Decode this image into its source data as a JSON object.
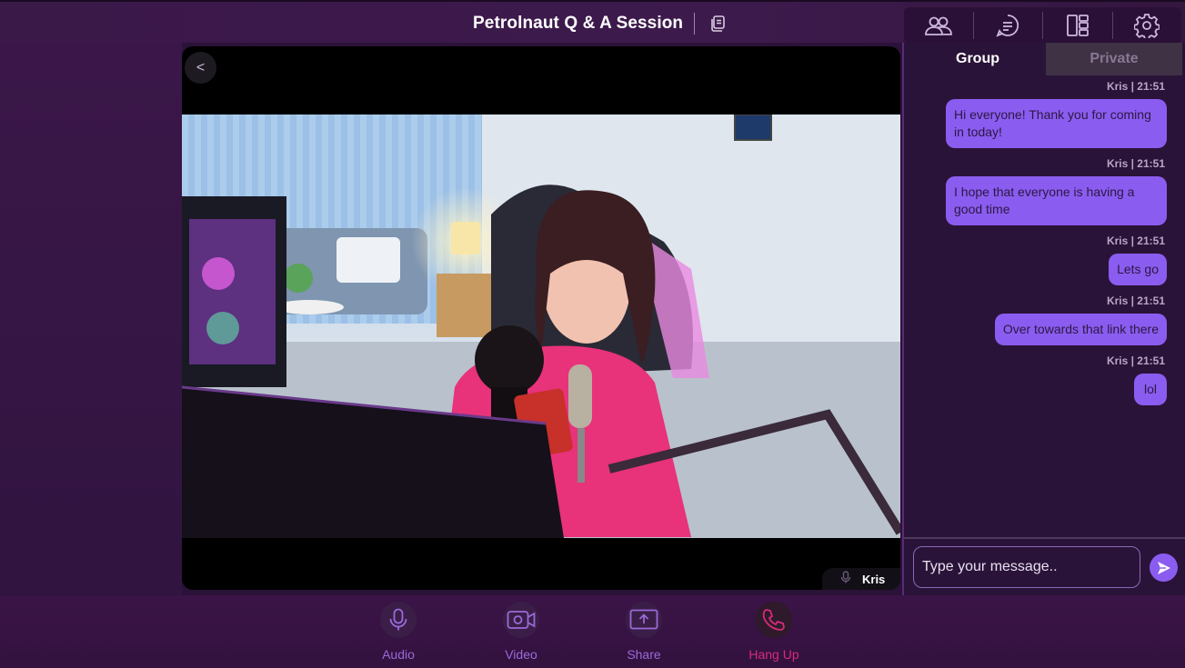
{
  "header": {
    "title": "Petrolnaut Q & A Session",
    "icons": [
      "copy-icon",
      "participants-icon",
      "chat-icon",
      "layout-icon",
      "settings-icon"
    ]
  },
  "video": {
    "back_label": "<",
    "speaker_name": "Kris"
  },
  "chat": {
    "tabs": [
      {
        "label": "Group",
        "active": true
      },
      {
        "label": "Private",
        "active": false
      }
    ],
    "messages": [
      {
        "meta": "Kris | 21:51",
        "text": "Hi everyone! Thank you for coming in today!"
      },
      {
        "meta": "Kris | 21:51",
        "text": "I hope that everyone is having a good time"
      },
      {
        "meta": "Kris | 21:51",
        "text": "Lets go"
      },
      {
        "meta": "Kris | 21:51",
        "text": "Over towards that link there"
      },
      {
        "meta": "Kris | 21:51",
        "text": "lol"
      }
    ],
    "input_placeholder": "Type your message..",
    "accent": "#8b5cf0"
  },
  "controls": {
    "audio": "Audio",
    "video": "Video",
    "share": "Share",
    "hangup": "Hang Up",
    "hangup_color": "#d62a7a"
  }
}
